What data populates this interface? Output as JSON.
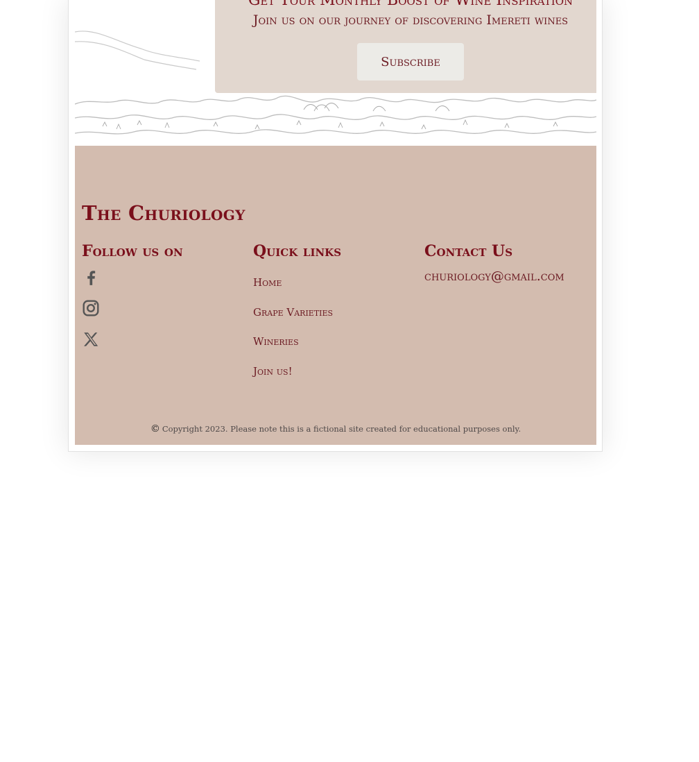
{
  "newsletter": {
    "title": "Get Your Monthly Boost of Wine Inspiration",
    "subtitle": "Join us on our journey of discovering Imereti wines",
    "button_label": "Subscribe"
  },
  "footer": {
    "brand": "The Churiology",
    "follow_title": "Follow us on",
    "social": [
      {
        "name": "facebook-icon"
      },
      {
        "name": "instagram-icon"
      },
      {
        "name": "x-twitter-icon"
      }
    ],
    "quick_links_title": "Quick links",
    "quick_links": [
      "Home",
      "Grape Varieties",
      "Wineries",
      "Join us!"
    ],
    "contact_title": "Contact Us",
    "email": "churiology@gmail.com",
    "copyright_symbol": "©",
    "copyright": "Copyright 2023. Please note this is a fictional site created for educational purposes only."
  },
  "colors": {
    "accent": "#7a0f1b",
    "footer_bg": "#d3bcaf",
    "card_bg": "#e2d7cf",
    "button_bg": "#ecebe7",
    "icon": "#555555"
  }
}
